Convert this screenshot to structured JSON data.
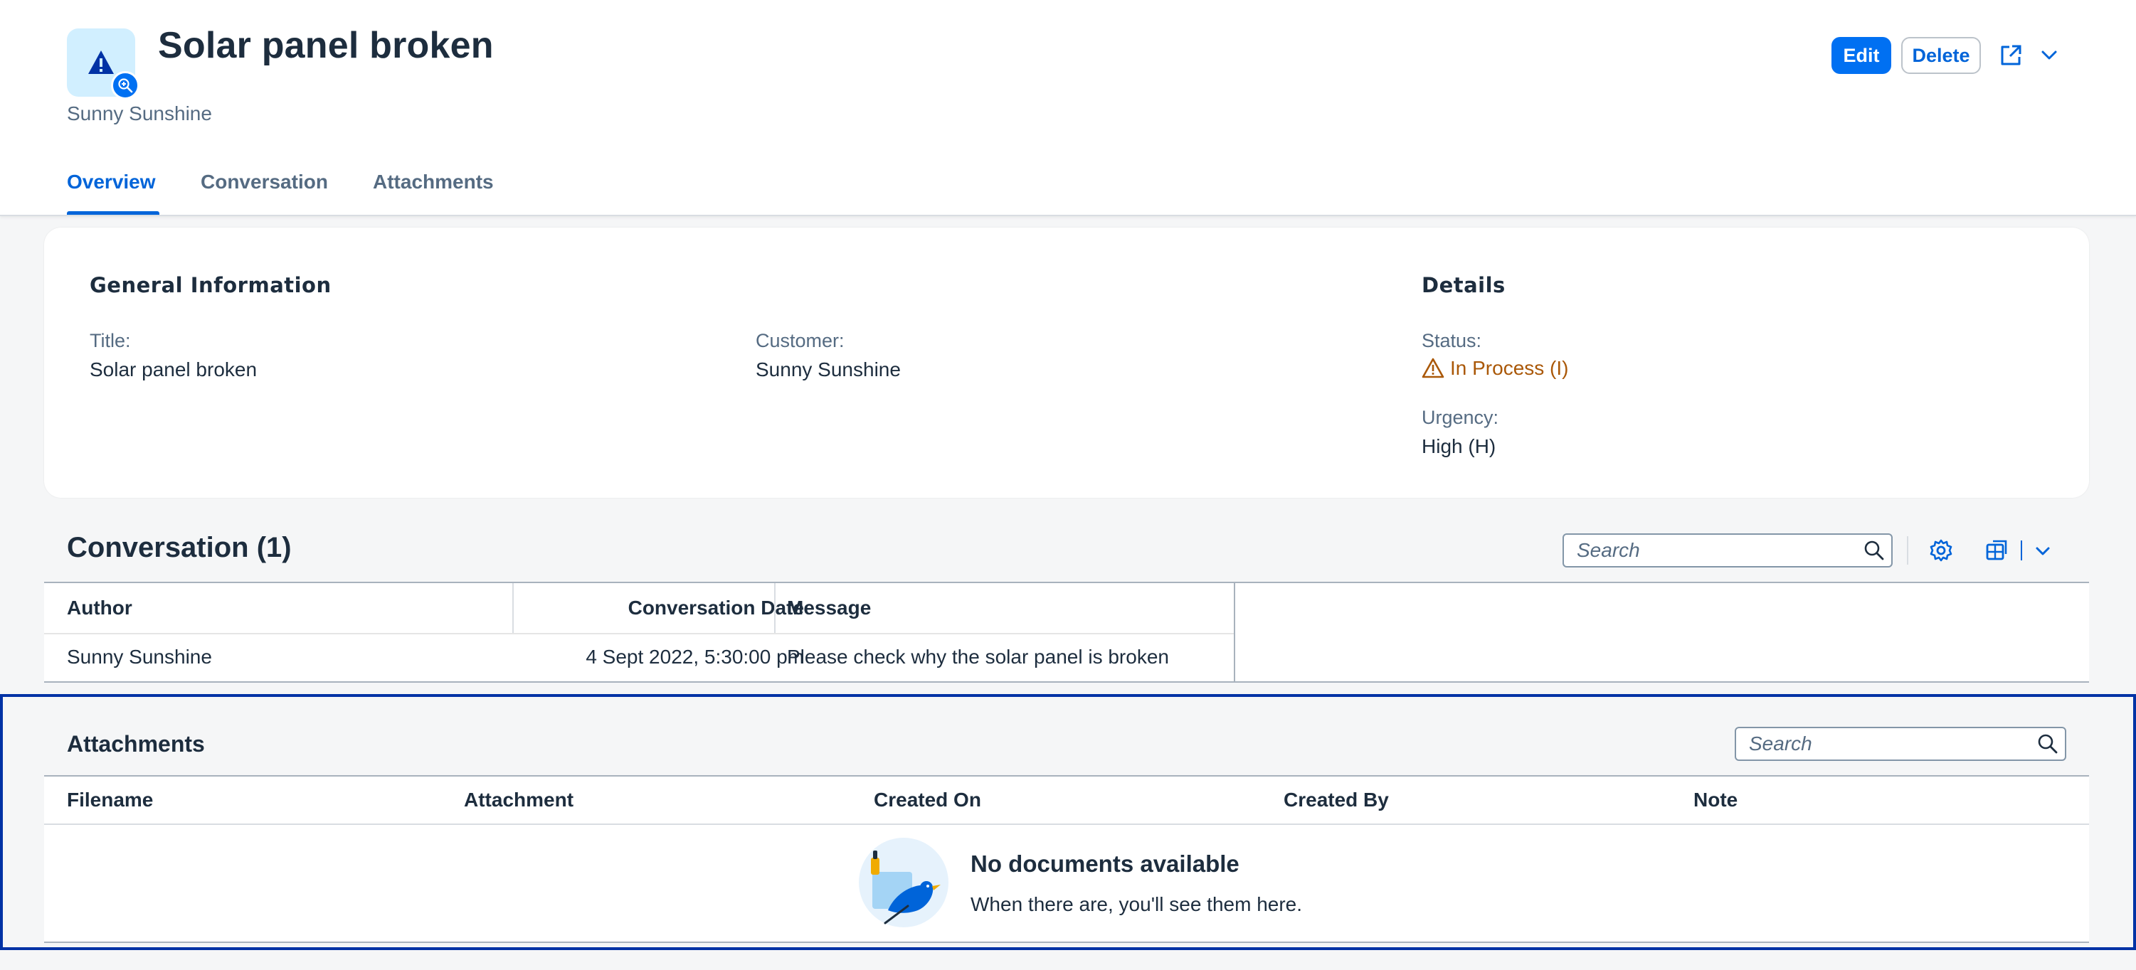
{
  "header": {
    "title": "Solar panel broken",
    "subtitle": "Sunny Sunshine",
    "actions": {
      "edit": "Edit",
      "delete": "Delete"
    },
    "avatar_icon": "warning-icon",
    "avatar_badge_icon": "zoom-in-icon"
  },
  "tabs": [
    "Overview",
    "Conversation",
    "Attachments"
  ],
  "overview": {
    "general_heading": "General Information",
    "details_heading": "Details",
    "title_label": "Title:",
    "title_value": "Solar panel broken",
    "customer_label": "Customer:",
    "customer_value": "Sunny Sunshine",
    "status_label": "Status:",
    "status_value": "In Process (I)",
    "status_color": "#aa5808",
    "urgency_label": "Urgency:",
    "urgency_value": "High (H)"
  },
  "conversation": {
    "title": "Conversation (1)",
    "search_placeholder": "Search",
    "columns": [
      "Author",
      "Conversation Date",
      "Message"
    ],
    "rows": [
      [
        "Sunny Sunshine",
        "4 Sept 2022, 5:30:00 pm",
        "Please check why the solar panel is broken"
      ]
    ]
  },
  "attachments": {
    "title": "Attachments",
    "search_placeholder": "Search",
    "columns": [
      "Filename",
      "Attachment",
      "Created On",
      "Created By",
      "Note"
    ],
    "empty_title": "No documents available",
    "empty_text": "When there are, you'll see them here."
  },
  "colors": {
    "accent": "#0070f2",
    "link": "#0064d9",
    "focus_border": "#0032a5",
    "warning": "#aa5808"
  }
}
